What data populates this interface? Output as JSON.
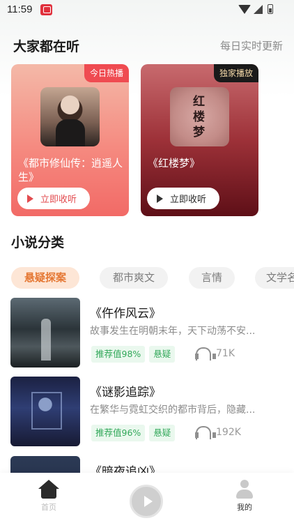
{
  "status_bar": {
    "time": "11:59"
  },
  "popular": {
    "title": "大家都在听",
    "more": "每日实时更新",
    "cards": [
      {
        "badge": "今日热播",
        "title": "《都市修仙传：逍遥人生》",
        "button": "立即收听"
      },
      {
        "badge": "独家播放",
        "title": "《红楼梦》",
        "cover_text": "红楼梦",
        "button": "立即收听"
      }
    ]
  },
  "category": {
    "title": "小说分类",
    "tabs": [
      "悬疑探案",
      "都市爽文",
      "言情",
      "文学名著"
    ],
    "active_tab": "悬疑探案"
  },
  "books": [
    {
      "title": "《仵作风云》",
      "desc": "故事发生在明朝末年，天下动荡不安...",
      "score": "推荐值98%",
      "tag": "悬疑",
      "listens": "71K"
    },
    {
      "title": "《谜影追踪》",
      "desc": "在繁华与霓虹交织的都市背后，隐藏...",
      "score": "推荐值96%",
      "tag": "悬疑",
      "listens": "192K"
    },
    {
      "title": "《暗夜追凶》"
    }
  ],
  "bottom_nav": {
    "home": "首页",
    "mine": "我的"
  },
  "colors": {
    "accent_orange": "#e57733",
    "tag_green": "#32a85a",
    "badge_red": "#ef4b51"
  }
}
